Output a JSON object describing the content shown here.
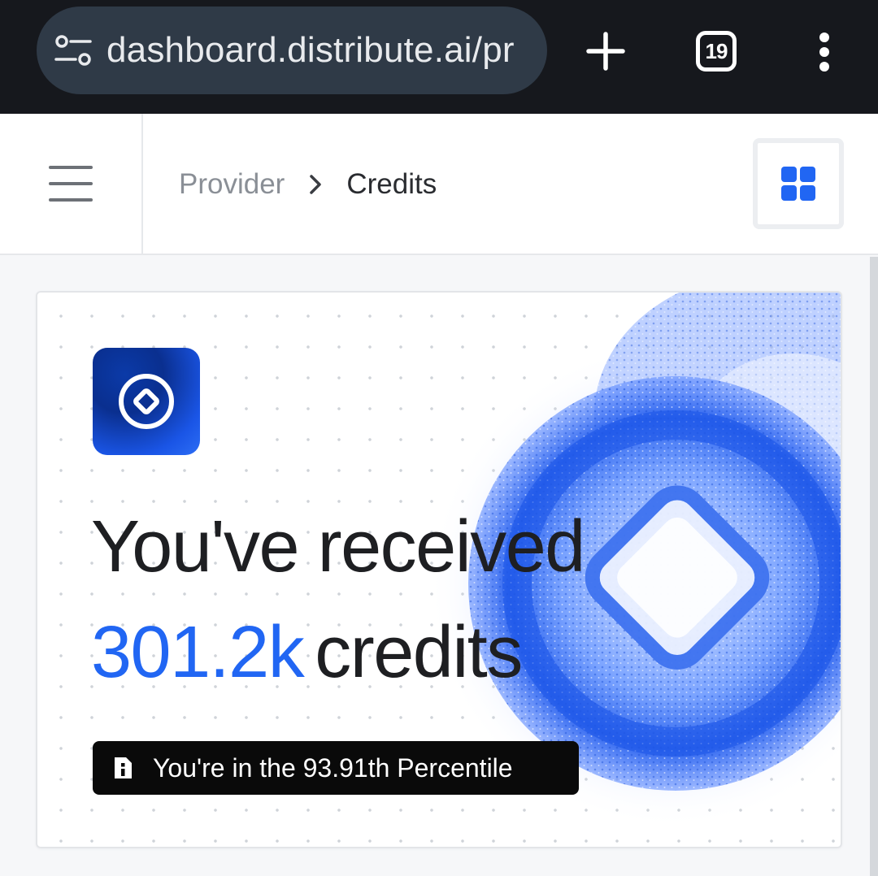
{
  "browser": {
    "url": "dashboard.distribute.ai/pr",
    "tab_count": "19",
    "site_info_icon": "tune-icon",
    "new_tab_icon": "plus-icon",
    "menu_icon": "more-vert-icon"
  },
  "header": {
    "menu_icon": "hamburger-icon",
    "breadcrumb": {
      "parent": "Provider",
      "current": "Credits"
    },
    "grid_icon": "grid-icon"
  },
  "card": {
    "logo_icon": "distribute-logo-icon",
    "headline": "You've received",
    "credits_value": "301.2k",
    "credits_unit": "credits",
    "percentile_icon": "info-icon",
    "percentile_text": "You're in the 93.91th Percentile"
  },
  "colors": {
    "accent": "#2166f3",
    "browser_bg": "#16181d",
    "urlbar_bg": "#2f3a47",
    "badge_bg": "#0a0a0a",
    "text_dark": "#1e1f22",
    "text_muted": "#8a8f96"
  }
}
